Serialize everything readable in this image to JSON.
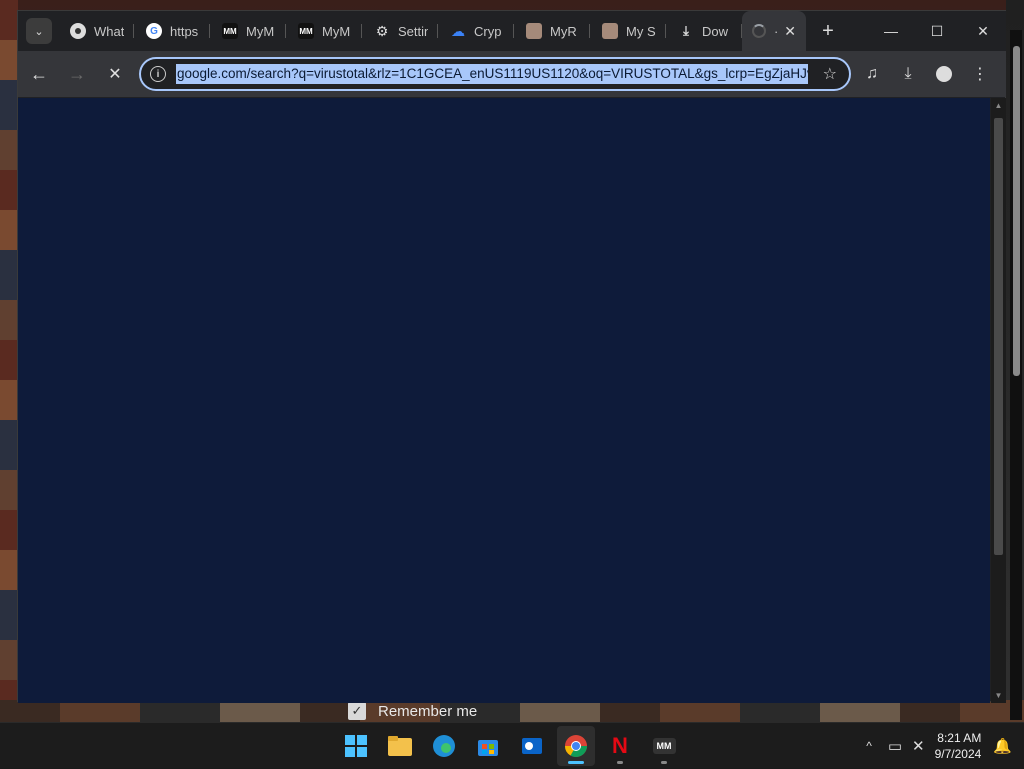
{
  "browser": {
    "tabs": [
      {
        "title": "What",
        "icon": "chrome-icon"
      },
      {
        "title": "https",
        "icon": "google-icon"
      },
      {
        "title": "MyM",
        "icon": "mm-icon"
      },
      {
        "title": "MyM",
        "icon": "mm-icon"
      },
      {
        "title": "Settin",
        "icon": "gear-icon"
      },
      {
        "title": "Cryp",
        "icon": "cloud-icon"
      },
      {
        "title": "MyR",
        "icon": "avatar-icon"
      },
      {
        "title": "My S",
        "icon": "avatar-icon"
      },
      {
        "title": "Dow",
        "icon": "download-icon"
      }
    ],
    "active_tab": {
      "title": "·",
      "close": "✕"
    },
    "new_tab": "+",
    "url": "google.com/search?q=virustotal&rlz=1C1GCEA_enUS1119US1120&oq=VIRUSTOTAL&gs_lcrp=EgZjaHJvbWUqBwgAEAAYgAQyBwgAEAAYgAQ",
    "content_bg": "#0e1b3a",
    "accent": "#a8c7fa"
  },
  "desktop": {
    "remember_me": "Remember me"
  },
  "taskbar": {
    "time": "8:21 AM",
    "date": "9/7/2024",
    "apps": [
      "start",
      "file-explorer",
      "edge",
      "store",
      "outlook",
      "chrome",
      "netflix",
      "mm"
    ]
  }
}
